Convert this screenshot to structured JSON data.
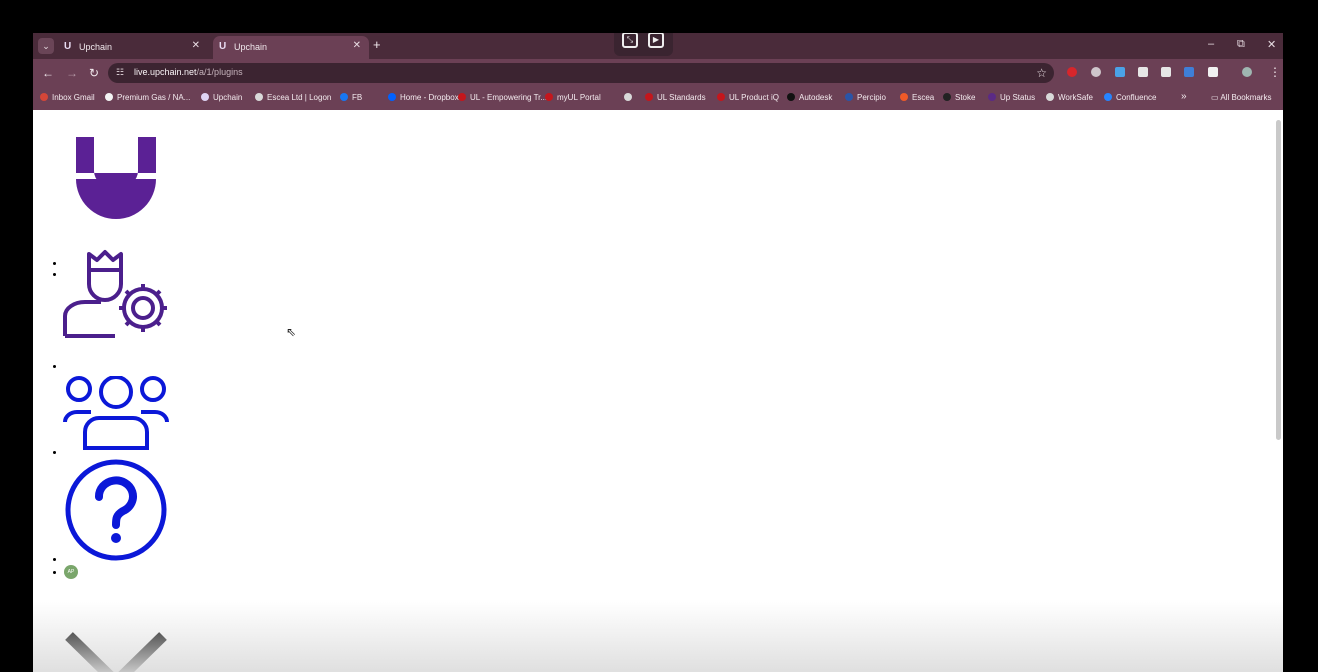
{
  "browser": {
    "tabs": [
      {
        "title": "Upchain",
        "favicon": "U"
      },
      {
        "title": "Upchain",
        "favicon": "U"
      }
    ],
    "new_tab_label": "+",
    "close_label": "✕",
    "url_host": "live.upchain.net",
    "url_path": "/a/1/plugins"
  },
  "bookmarks": [
    {
      "label": "Inbox Gmail",
      "icon": "gmail-icon",
      "color": "#d44638"
    },
    {
      "label": "Premium Gas / NA...",
      "icon": "bookmark-icon",
      "color": "#f4f4f4"
    },
    {
      "label": "Upchain",
      "icon": "upchain-icon",
      "color": "#e0d5f5"
    },
    {
      "label": "Escea Ltd | Logon",
      "icon": "globe-icon",
      "color": "#d9d9d9"
    },
    {
      "label": "FB",
      "icon": "facebook-icon",
      "color": "#1877f2"
    },
    {
      "label": "Home - Dropbox",
      "icon": "dropbox-icon",
      "color": "#0061ff"
    },
    {
      "label": "UL - Empowering Tr...",
      "icon": "ul-icon",
      "color": "#c4161c"
    },
    {
      "label": "myUL Portal",
      "icon": "ul-icon",
      "color": "#c4161c"
    },
    {
      "label": "",
      "icon": "globe-icon",
      "color": "#d9d9d9"
    },
    {
      "label": "UL Standards",
      "icon": "ul-icon",
      "color": "#c4161c"
    },
    {
      "label": "UL Product iQ",
      "icon": "ul-icon",
      "color": "#c4161c"
    },
    {
      "label": "Autodesk",
      "icon": "autodesk-icon",
      "color": "#111111"
    },
    {
      "label": "Percipio",
      "icon": "percipio-icon",
      "color": "#2a55a8"
    },
    {
      "label": "Escea",
      "icon": "escea-icon",
      "color": "#f05a28"
    },
    {
      "label": "Stoke",
      "icon": "stoke-icon",
      "color": "#222222"
    },
    {
      "label": "Up Status",
      "icon": "upchain-icon",
      "color": "#5b2a86"
    },
    {
      "label": "WorkSafe",
      "icon": "globe-icon",
      "color": "#d9d9d9"
    },
    {
      "label": "Confluence",
      "icon": "confluence-icon",
      "color": "#2684ff"
    }
  ],
  "bookmarks_more": "»",
  "all_bookmarks": "All Bookmarks",
  "app": {
    "avatar_initials": "AP",
    "colors": {
      "brand": "#5b2195",
      "admin_icon": "#4b1f8c",
      "nav_icon": "#0b18d8",
      "chevron": "#000000"
    }
  }
}
